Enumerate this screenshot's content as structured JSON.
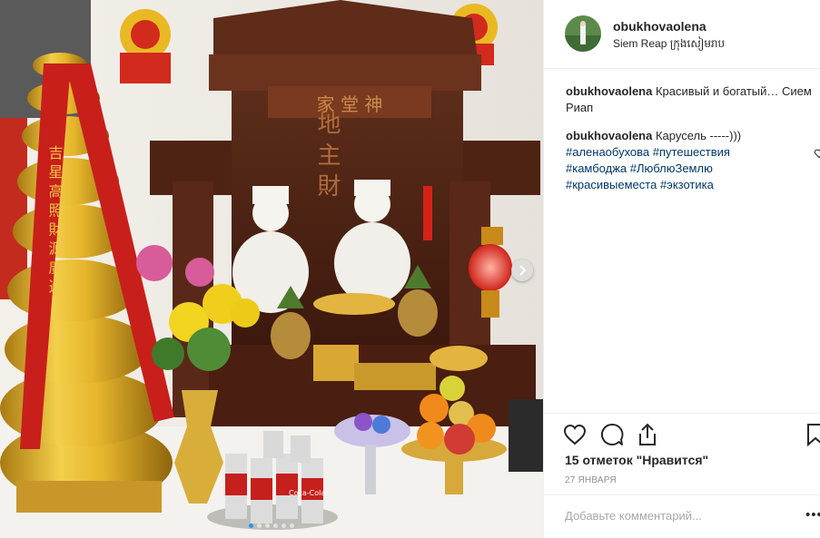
{
  "post": {
    "username": "obukhovaolena",
    "location": "Siem Reap ក្រុងសៀមរាប",
    "caption": {
      "user": "obukhovaolena",
      "text": "Красивый и богатый… Сием Риап"
    },
    "comment": {
      "user": "obukhovaolena",
      "text": "Карусель -----)))",
      "hashtags": [
        "#аленаобухова",
        "#путешествия",
        "#камбоджа",
        "#ЛюблюЗемлю",
        "#красивыеместа",
        "#экзотика"
      ]
    },
    "likes": "15 отметок \"Нравится\"",
    "date": "27 ЯНВАРЯ",
    "comment_placeholder": "Добавьте комментарий...",
    "more_label": "•••"
  },
  "photo": {
    "altar_top_text": "家 堂 神",
    "altar_main_text": "地 主 財",
    "banner_text": "吉 星 高 照 財 源 廣 進",
    "cans_brand": "Coca-Cola"
  },
  "carousel": {
    "count": 6,
    "active_index": 0
  },
  "icons": {
    "like": "heart-icon",
    "comment": "comment-bubble-icon",
    "share": "share-icon",
    "save": "bookmark-icon",
    "next": "chevron-right-icon"
  },
  "colors": {
    "hashtag": "#00376b",
    "carousel_active": "#1e9bf0",
    "divider": "#efefef",
    "muted": "#8e8e8e"
  }
}
